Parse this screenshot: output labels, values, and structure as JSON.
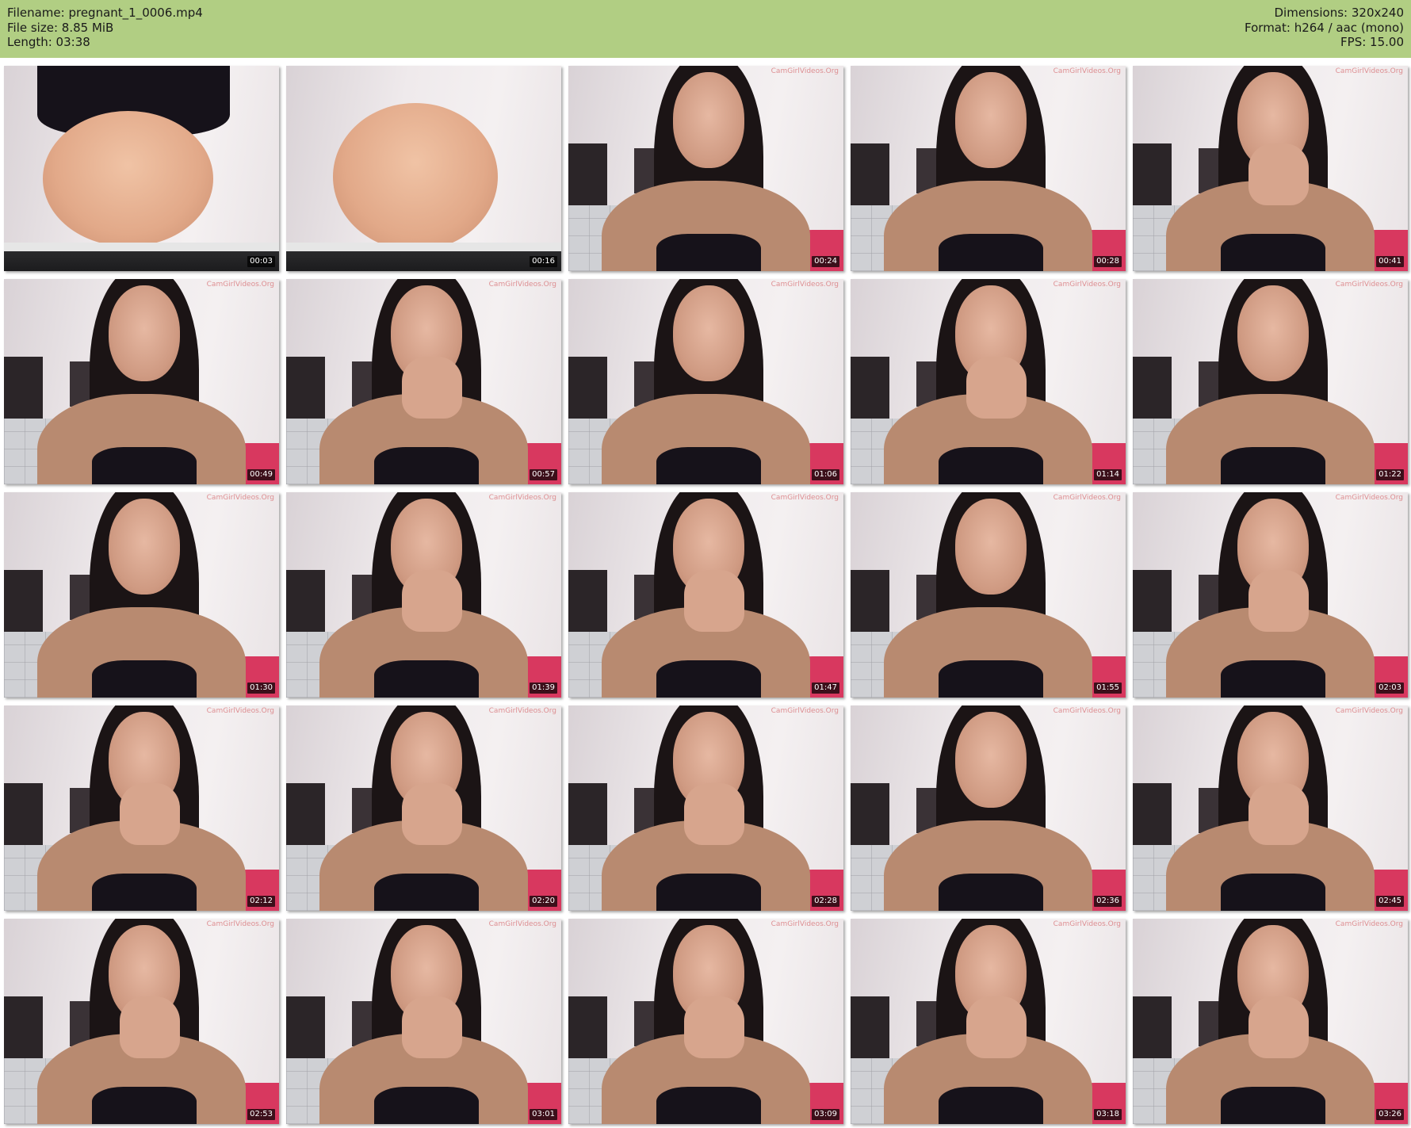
{
  "header": {
    "filename": "Filename: pregnant_1_0006.mp4",
    "file_size": "File size: 8.85 MiB",
    "length": "Length: 03:38",
    "dimensions": "Dimensions: 320x240",
    "format": "Format: h264 / aac (mono)",
    "fps": "FPS: 15.00",
    "background_color": "#b1ce83"
  },
  "watermark": "CamGirlVideos.Org",
  "thumbnails": [
    {
      "time": "00:03",
      "scene": "belly"
    },
    {
      "time": "00:16",
      "scene": "belly-close"
    },
    {
      "time": "00:24",
      "scene": "face"
    },
    {
      "time": "00:28",
      "scene": "face"
    },
    {
      "time": "00:41",
      "scene": "face-hand"
    },
    {
      "time": "00:49",
      "scene": "face"
    },
    {
      "time": "00:57",
      "scene": "face-hand"
    },
    {
      "time": "01:06",
      "scene": "face"
    },
    {
      "time": "01:14",
      "scene": "face-hand"
    },
    {
      "time": "01:22",
      "scene": "face"
    },
    {
      "time": "01:30",
      "scene": "face"
    },
    {
      "time": "01:39",
      "scene": "face-hand"
    },
    {
      "time": "01:47",
      "scene": "face-hand"
    },
    {
      "time": "01:55",
      "scene": "face"
    },
    {
      "time": "02:03",
      "scene": "face-hand"
    },
    {
      "time": "02:12",
      "scene": "face-hand"
    },
    {
      "time": "02:20",
      "scene": "face-hand"
    },
    {
      "time": "02:28",
      "scene": "face-hand"
    },
    {
      "time": "02:36",
      "scene": "face"
    },
    {
      "time": "02:45",
      "scene": "face-hand"
    },
    {
      "time": "02:53",
      "scene": "face-hand"
    },
    {
      "time": "03:01",
      "scene": "face-hand"
    },
    {
      "time": "03:09",
      "scene": "face-hand"
    },
    {
      "time": "03:18",
      "scene": "face-hand"
    },
    {
      "time": "03:26",
      "scene": "face-hand"
    }
  ]
}
